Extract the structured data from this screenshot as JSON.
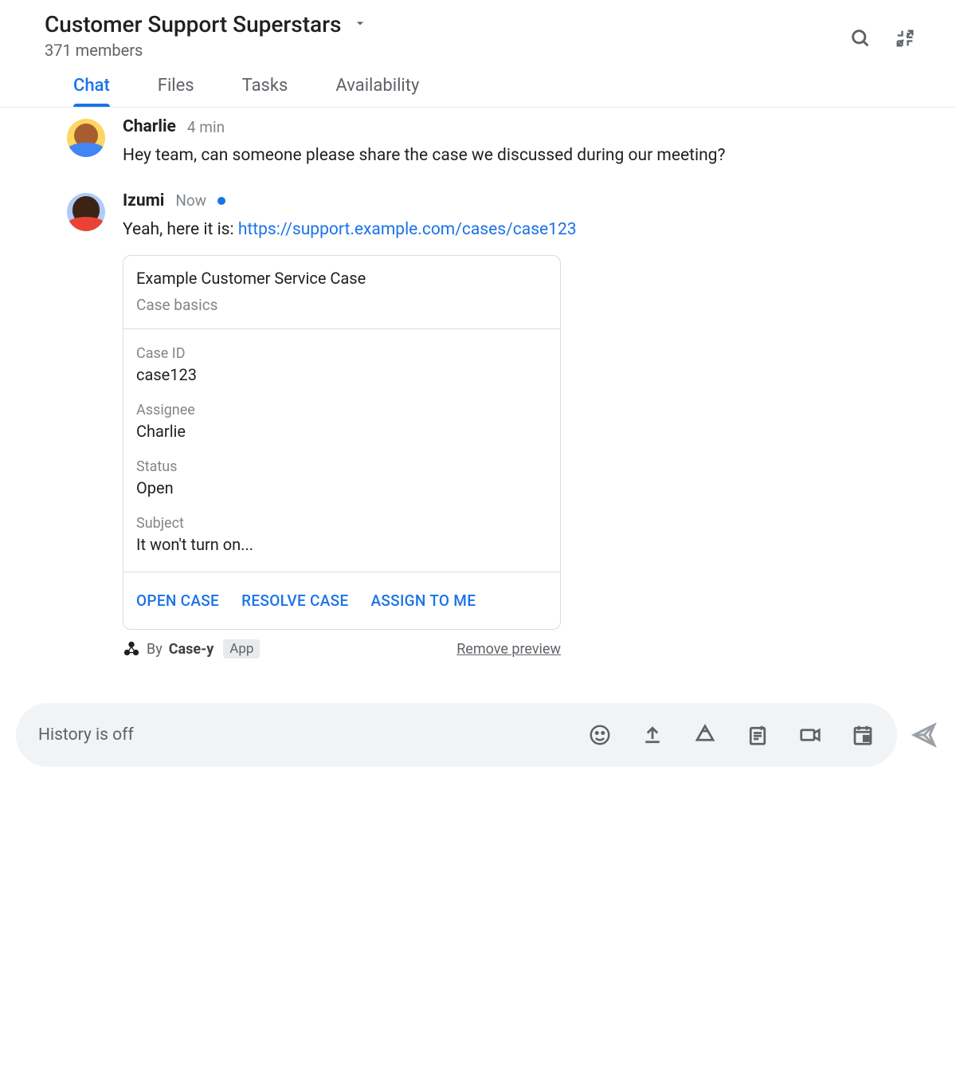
{
  "header": {
    "title": "Customer Support Superstars",
    "members": "371 members"
  },
  "tabs": [
    {
      "label": "Chat",
      "active": true
    },
    {
      "label": "Files",
      "active": false
    },
    {
      "label": "Tasks",
      "active": false
    },
    {
      "label": "Availability",
      "active": false
    }
  ],
  "messages": [
    {
      "sender": "Charlie",
      "time": "4 min",
      "text": "Hey team, can someone please share the case we discussed during our meeting?"
    },
    {
      "sender": "Izumi",
      "time": "Now",
      "text_prefix": "Yeah, here it is: ",
      "link_text": "https://support.example.com/cases/case123"
    }
  ],
  "card": {
    "title": "Example Customer Service Case",
    "subtitle": "Case basics",
    "fields": [
      {
        "label": "Case ID",
        "value": "case123"
      },
      {
        "label": "Assignee",
        "value": "Charlie"
      },
      {
        "label": "Status",
        "value": "Open"
      },
      {
        "label": "Subject",
        "value": "It won't turn on..."
      }
    ],
    "actions": [
      "OPEN CASE",
      "RESOLVE CASE",
      "ASSIGN TO ME"
    ]
  },
  "attribution": {
    "by": "By",
    "app": "Case-y",
    "badge": "App",
    "remove": "Remove preview"
  },
  "composer": {
    "placeholder": "History is off"
  }
}
